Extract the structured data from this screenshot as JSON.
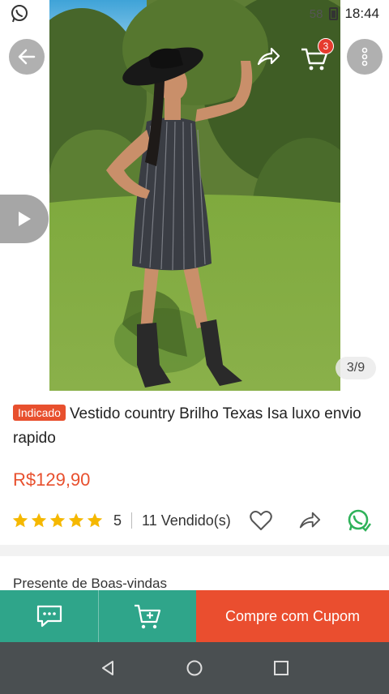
{
  "status_bar": {
    "time": "18:44",
    "battery_text": "58",
    "whatsapp_icon": "whatsapp-icon"
  },
  "hero": {
    "image_counter": "3/9",
    "cart_badge": "3",
    "icons": [
      "back-arrow-icon",
      "share-icon",
      "cart-icon",
      "more-vertical-icon",
      "play-icon"
    ]
  },
  "product": {
    "tag": "Indicado",
    "title": "Vestido country Brilho Texas Isa luxo envio rapido",
    "price": "R$129,90",
    "rating": "5",
    "sold": "11 Vendido(s)",
    "star_color": "#f5b800"
  },
  "section": {
    "welcome_label": "Presente de Boas-vindas"
  },
  "action_bar": {
    "buy_label": "Compre com Cupom",
    "chat_icon": "chat-icon",
    "add_cart_icon": "add-to-cart-icon"
  },
  "colors": {
    "accent": "#e8502e",
    "teal": "#2fa58a",
    "nav": "#4a4f51"
  }
}
